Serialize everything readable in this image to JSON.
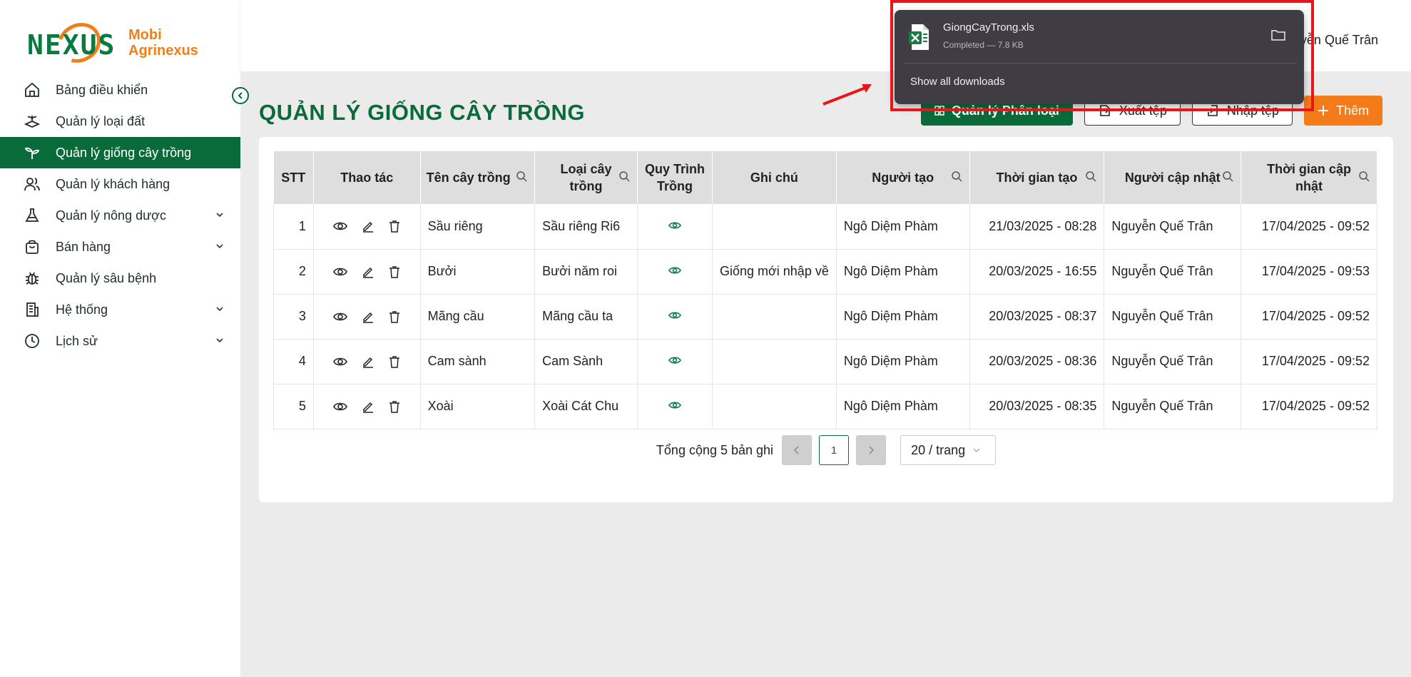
{
  "brand": {
    "logo_word": "NEXUS",
    "line1": "Mobi",
    "line2": "Agrinexus"
  },
  "sidebar": {
    "items": [
      {
        "label": "Bảng điều khiển",
        "icon": "home-icon"
      },
      {
        "label": "Quản lý loại đất",
        "icon": "soil-icon"
      },
      {
        "label": "Quản lý giống cây trồng",
        "icon": "plant-icon",
        "active": true
      },
      {
        "label": "Quản lý khách hàng",
        "icon": "users-icon"
      },
      {
        "label": "Quản lý nông dược",
        "icon": "flask-icon",
        "expandable": true
      },
      {
        "label": "Bán hàng",
        "icon": "bag-icon",
        "expandable": true
      },
      {
        "label": "Quản lý sâu bệnh",
        "icon": "bug-icon"
      },
      {
        "label": "Hệ thống",
        "icon": "building-icon",
        "expandable": true
      },
      {
        "label": "Lịch sử",
        "icon": "clock-icon",
        "expandable": true
      }
    ]
  },
  "header": {
    "user_name": "yễn Quế Trân"
  },
  "page": {
    "title": "QUẢN LÝ GIỐNG CÂY TRỒNG"
  },
  "toolbar": {
    "category_button": "Quản lý Phân loại",
    "export_button": "Xuất tệp",
    "import_button": "Nhập tệp",
    "add_button": "Thêm"
  },
  "table": {
    "headers": [
      "STT",
      "Thao tác",
      "Tên cây trồng",
      "Loại cây trồng",
      "Quy Trình Trồng",
      "Ghi chú",
      "Người tạo",
      "Thời gian tạo",
      "Người cập nhật",
      "Thời gian cập nhật"
    ],
    "rows": [
      {
        "stt": "1",
        "name": "Sầu riêng",
        "type": "Sầu riêng Ri6",
        "note": "",
        "creator": "Ngô Diệm Phàm",
        "created": "21/03/2025 - 08:28",
        "updater": "Nguyễn Quế Trân",
        "updated": "17/04/2025 - 09:52"
      },
      {
        "stt": "2",
        "name": "Bưởi",
        "type": "Bưởi năm roi",
        "note": "Giống mới nhập về",
        "creator": "Ngô Diệm Phàm",
        "created": "20/03/2025 - 16:55",
        "updater": "Nguyễn Quế Trân",
        "updated": "17/04/2025 - 09:53"
      },
      {
        "stt": "3",
        "name": "Mãng cầu",
        "type": "Mãng cầu ta",
        "note": "",
        "creator": "Ngô Diệm Phàm",
        "created": "20/03/2025 - 08:37",
        "updater": "Nguyễn Quế Trân",
        "updated": "17/04/2025 - 09:52"
      },
      {
        "stt": "4",
        "name": "Cam sành",
        "type": "Cam Sành",
        "note": "",
        "creator": "Ngô Diệm Phàm",
        "created": "20/03/2025 - 08:36",
        "updater": "Nguyễn Quế Trân",
        "updated": "17/04/2025 - 09:52"
      },
      {
        "stt": "5",
        "name": "Xoài",
        "type": "Xoài Cát Chu",
        "note": "",
        "creator": "Ngô Diệm Phàm",
        "created": "20/03/2025 - 08:35",
        "updater": "Nguyễn Quế Trân",
        "updated": "17/04/2025 - 09:52"
      }
    ]
  },
  "pagination": {
    "total_text": "Tổng cộng 5 bản ghi",
    "current_page": "1",
    "page_size": "20 / trang"
  },
  "download": {
    "file_name": "GiongCayTrong.xls",
    "status": "Completed — 7.8 KB",
    "show_all": "Show all downloads"
  },
  "colors": {
    "primary_green": "#0a6b3a",
    "accent_orange": "#f47b1a",
    "highlight_red": "#e8151b"
  }
}
